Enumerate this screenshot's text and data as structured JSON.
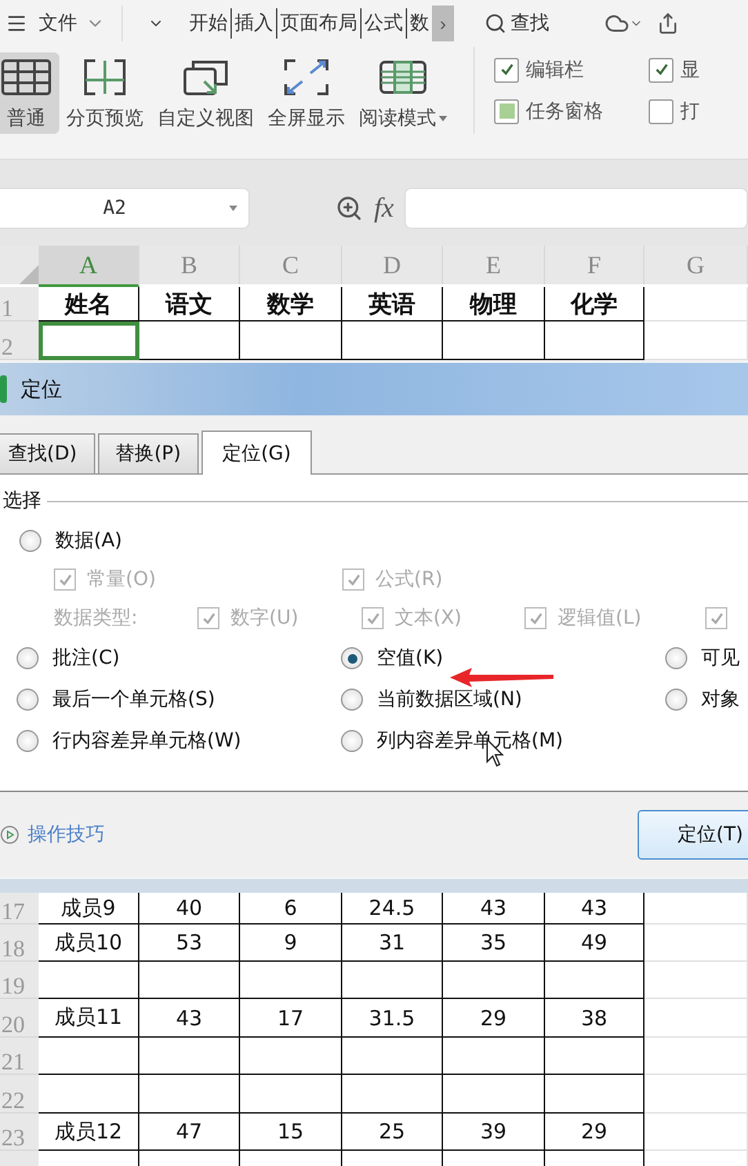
{
  "menu_bar": {
    "file_menu": "文件",
    "tabs": [
      {
        "label": "开始"
      },
      {
        "label": "插入"
      },
      {
        "label": "页面布局"
      },
      {
        "label": "公式"
      },
      {
        "label": "数"
      }
    ],
    "more": "›",
    "search": "查找"
  },
  "ribbon": {
    "views": [
      {
        "label": "普通",
        "selected": true,
        "kind": "normal"
      },
      {
        "label": "分页预览",
        "selected": false,
        "kind": "pagebreak"
      },
      {
        "label": "自定义视图",
        "selected": false,
        "kind": "custom"
      },
      {
        "label": "全屏显示",
        "selected": false,
        "kind": "fullscreen"
      },
      {
        "label": "阅读模式",
        "selected": false,
        "kind": "reading",
        "dropdown": true
      }
    ],
    "checkboxes": [
      {
        "label": "编辑栏",
        "checked": true,
        "kind": "tick"
      },
      {
        "label": "显",
        "checked": true,
        "kind": "tick"
      },
      {
        "label": "任务窗格",
        "checked": true,
        "kind": "fill"
      },
      {
        "label": "打",
        "checked": false,
        "kind": "tick"
      }
    ]
  },
  "formula_bar": {
    "name_box": "A2",
    "fx": "fx"
  },
  "sheet_top": {
    "columns": [
      {
        "label": "A",
        "selected": true
      },
      {
        "label": "B",
        "selected": false
      },
      {
        "label": "C",
        "selected": false
      },
      {
        "label": "D",
        "selected": false
      },
      {
        "label": "E",
        "selected": false
      },
      {
        "label": "F",
        "selected": false
      },
      {
        "label": "G",
        "selected": false
      }
    ],
    "rows": [
      {
        "number": "1",
        "header": true,
        "cells": [
          "姓名",
          "语文",
          "数学",
          "英语",
          "物理",
          "化学"
        ]
      },
      {
        "number": "2",
        "active_first": true
      }
    ]
  },
  "dialog": {
    "title": "定位",
    "tabs": [
      {
        "label": "查找(D)",
        "selected": false
      },
      {
        "label": "替换(P)",
        "selected": false
      },
      {
        "label": "定位(G)",
        "selected": true
      }
    ],
    "group_label": "选择",
    "data_option": {
      "label": "数据(A)",
      "selected": false
    },
    "constant_checks": [
      {
        "label": "常量(O)",
        "checked": true,
        "disabled": true
      },
      {
        "label": "公式(R)",
        "checked": true,
        "disabled": true
      }
    ],
    "data_type": {
      "label": "数据类型:",
      "disabled": true,
      "checks": [
        {
          "label": "数字(U)",
          "checked": true,
          "disabled": true
        },
        {
          "label": "文本(X)",
          "checked": true,
          "disabled": true
        },
        {
          "label": "逻辑值(L)",
          "checked": true,
          "disabled": true
        },
        {
          "checked": true,
          "disabled": true
        }
      ]
    },
    "radio_options": [
      {
        "label": "批注(C)",
        "selected": false
      },
      {
        "label": "空值(K)",
        "selected": true
      },
      {
        "label": "可见",
        "selected": false
      },
      {
        "label": "最后一个单元格(S)",
        "selected": false
      },
      {
        "label": "当前数据区域(N)",
        "selected": false
      },
      {
        "label": "对象",
        "selected": false
      },
      {
        "label": "行内容差异单元格(W)",
        "selected": false
      },
      {
        "label": "列内容差异单元格(M)",
        "selected": false
      }
    ],
    "tips_link": "操作技巧",
    "confirm_button": "定位(T)"
  },
  "sheet_bottom": {
    "rows": [
      {
        "number": "17",
        "cells": [
          "成员9",
          "40",
          "6",
          "24.5",
          "43",
          "43"
        ]
      },
      {
        "number": "18",
        "cells": [
          "成员10",
          "53",
          "9",
          "31",
          "35",
          "49"
        ]
      },
      {
        "number": "19"
      },
      {
        "number": "20",
        "cells": [
          "成员11",
          "43",
          "17",
          "31.5",
          "29",
          "38"
        ]
      },
      {
        "number": "21"
      },
      {
        "number": "22"
      },
      {
        "number": "23",
        "cells": [
          "成员12",
          "47",
          "15",
          "25",
          "39",
          "29"
        ]
      }
    ]
  }
}
